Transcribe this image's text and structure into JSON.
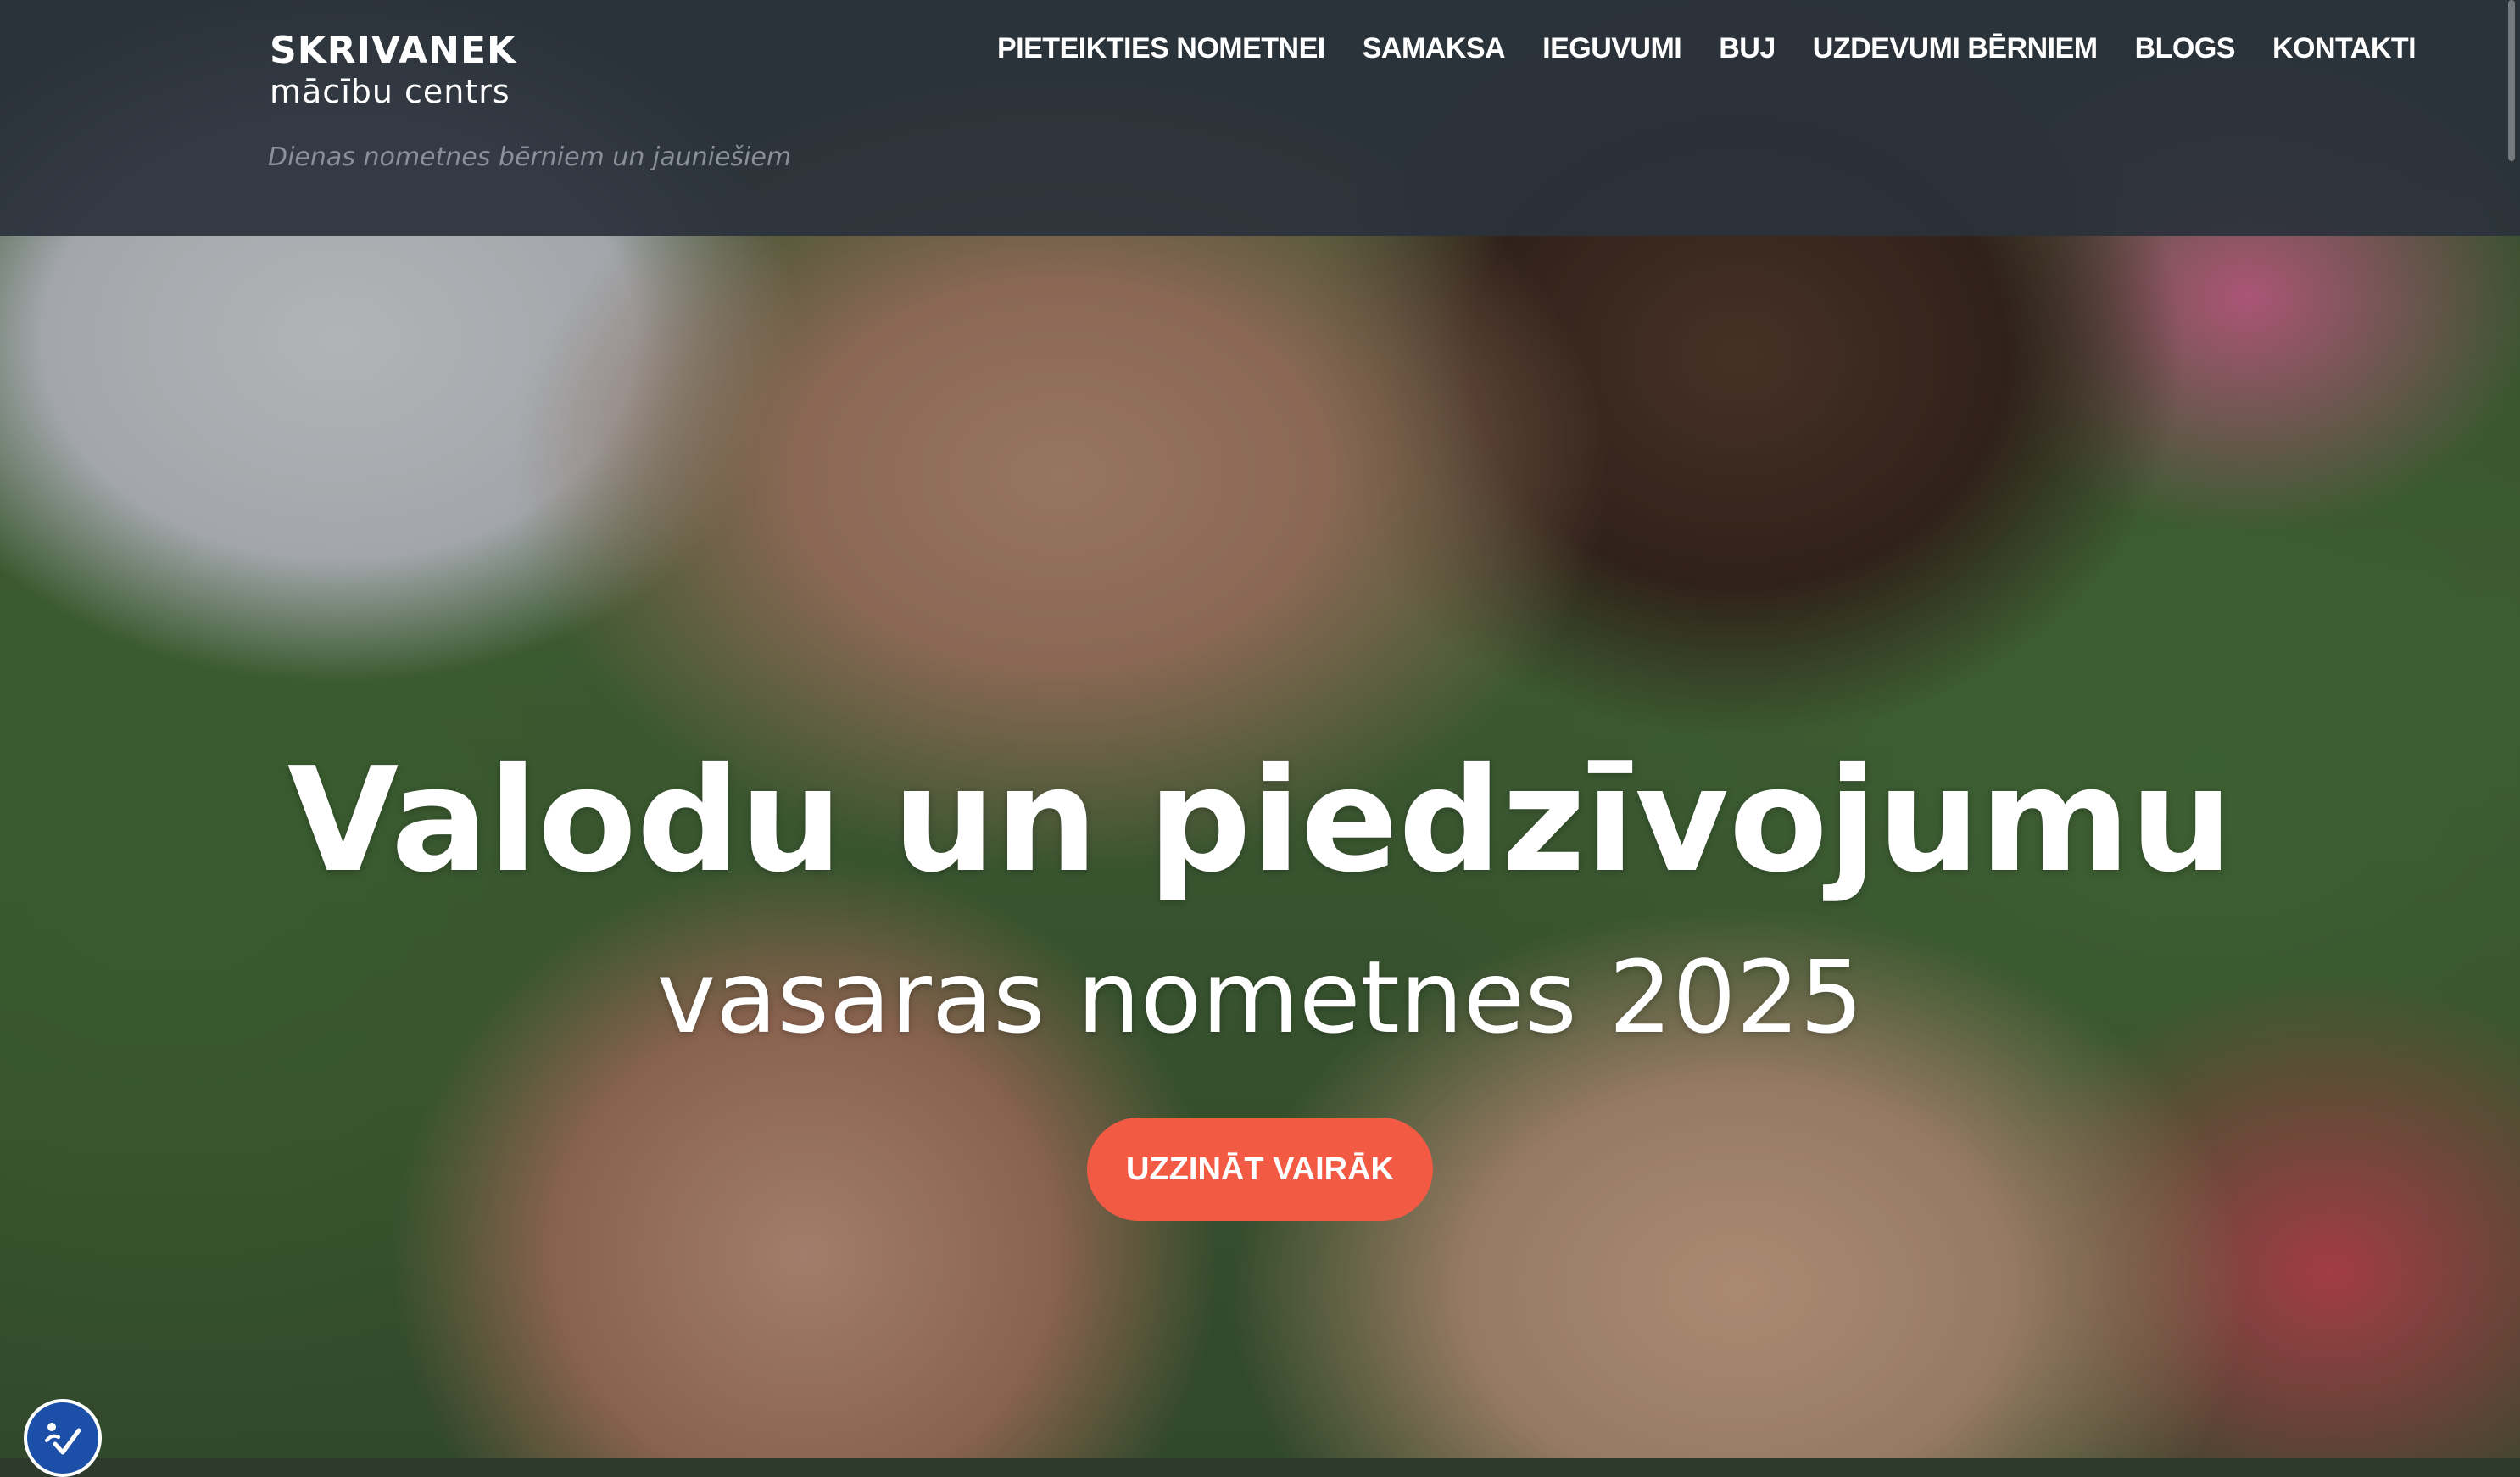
{
  "brand": {
    "name": "SKRIVANEK",
    "subname": "mācību centrs",
    "tagline": "Dienas nometnes bērniem un jauniešiem"
  },
  "nav": {
    "items": [
      {
        "label": "PIETEIKTIES NOMETNEI"
      },
      {
        "label": "SAMAKSA"
      },
      {
        "label": "IEGUVUMI"
      },
      {
        "label": "BUJ"
      },
      {
        "label": "UZDEVUMI BĒRNIEM"
      },
      {
        "label": "BLOGS"
      },
      {
        "label": "KONTAKTI"
      }
    ]
  },
  "hero": {
    "title": "Valodu un piedzīvojumu",
    "subtitle": "vasaras nometnes 2025",
    "cta_label": "UZZINĀT VAIRĀK"
  },
  "icons": {
    "accessibility": "accessibility-check-icon"
  },
  "colors": {
    "header_bg": "#2b313b",
    "accent": "#f25a44",
    "accessibility": "#1c4fa8"
  }
}
